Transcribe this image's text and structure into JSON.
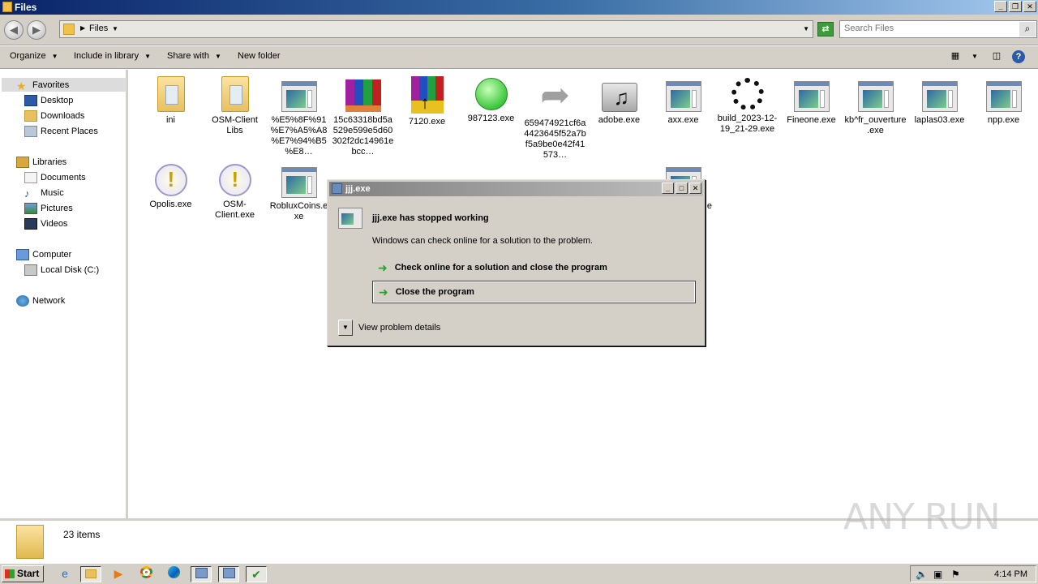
{
  "window": {
    "title": "Files"
  },
  "address": {
    "crumb": "Files"
  },
  "search": {
    "placeholder": "Search Files"
  },
  "toolbar": {
    "organize": "Organize",
    "include_in_library": "Include in library",
    "share_with": "Share with",
    "new_folder": "New folder"
  },
  "nav": {
    "favorites": "Favorites",
    "desktop": "Desktop",
    "downloads": "Downloads",
    "recent_places": "Recent Places",
    "libraries": "Libraries",
    "documents": "Documents",
    "music": "Music",
    "pictures": "Pictures",
    "videos": "Videos",
    "computer": "Computer",
    "local_disk": "Local Disk (C:)",
    "network": "Network"
  },
  "files": [
    {
      "label": "ini",
      "icon": "folder-icon"
    },
    {
      "label": "OSM-Client Libs",
      "icon": "folder-icon"
    },
    {
      "label": "%E5%8F%91%E7%A5%A8%E7%94%B5%E8…",
      "icon": "exe-icon"
    },
    {
      "label": "15c63318bd5a529e599e5d60302f2dc14961ebcc…",
      "icon": "winrar-archive-icon"
    },
    {
      "label": "7120.exe",
      "icon": "winrar-icon"
    },
    {
      "label": "987123.exe",
      "icon": "green-circle-icon"
    },
    {
      "label": "659474921cf6a4423645f52a7bf5a9be0e42f41573…",
      "icon": "shortcut-arrow-icon"
    },
    {
      "label": "adobe.exe",
      "icon": "music-icon"
    },
    {
      "label": "axx.exe",
      "icon": "exe-icon"
    },
    {
      "label": "build_2023-12-19_21-29.exe",
      "icon": "spinner-icon"
    },
    {
      "label": "Fineone.exe",
      "icon": "exe-icon"
    },
    {
      "label": "kb^fr_ouverture.exe",
      "icon": "exe-icon"
    },
    {
      "label": "laplas03.exe",
      "icon": "exe-icon"
    },
    {
      "label": "npp.exe",
      "icon": "exe-icon"
    },
    {
      "label": "Opolis.exe",
      "icon": "warning-icon"
    },
    {
      "label": "OSM-Client.exe",
      "icon": "warning-icon"
    },
    {
      "label": "RobluxCoins.exe",
      "icon": "exe-icon"
    },
    {
      "label": "e",
      "icon": "exe-icon"
    }
  ],
  "status": {
    "item_count": "23 items"
  },
  "dialog": {
    "title": "jjj.exe",
    "heading": "jjj.exe has stopped working",
    "description": "Windows can check online for a solution to the problem.",
    "option_check_online": "Check online for a solution and close the program",
    "option_close": "Close the program",
    "view_details": "View problem details"
  },
  "taskbar": {
    "start": "Start",
    "clock": "4:14 PM"
  },
  "watermark": "ANY RUN"
}
